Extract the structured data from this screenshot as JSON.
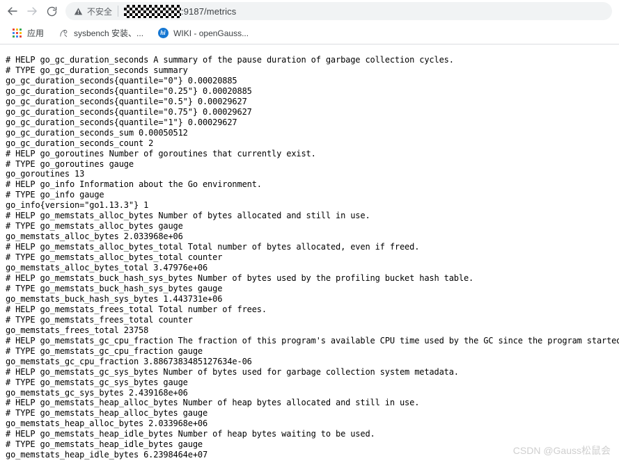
{
  "browser": {
    "nav": {
      "back_icon": "arrow-left-icon",
      "forward_icon": "arrow-right-icon",
      "reload_icon": "reload-icon"
    },
    "omnibox": {
      "security_icon": "warning-triangle-icon",
      "security_label": "不安全",
      "redacted_host": "",
      "url_visible": ":9187/metrics"
    },
    "bookmarks": [
      {
        "icon": "apps-grid-icon",
        "label": "应用"
      },
      {
        "icon": "sysbench-favicon",
        "label": "sysbench 安装、..."
      },
      {
        "icon": "opengauss-wiki-favicon",
        "label": "WIKI - openGauss..."
      }
    ]
  },
  "page": {
    "content": "# HELP go_gc_duration_seconds A summary of the pause duration of garbage collection cycles.\n# TYPE go_gc_duration_seconds summary\ngo_gc_duration_seconds{quantile=\"0\"} 0.00020885\ngo_gc_duration_seconds{quantile=\"0.25\"} 0.00020885\ngo_gc_duration_seconds{quantile=\"0.5\"} 0.00029627\ngo_gc_duration_seconds{quantile=\"0.75\"} 0.00029627\ngo_gc_duration_seconds{quantile=\"1\"} 0.00029627\ngo_gc_duration_seconds_sum 0.00050512\ngo_gc_duration_seconds_count 2\n# HELP go_goroutines Number of goroutines that currently exist.\n# TYPE go_goroutines gauge\ngo_goroutines 13\n# HELP go_info Information about the Go environment.\n# TYPE go_info gauge\ngo_info{version=\"go1.13.3\"} 1\n# HELP go_memstats_alloc_bytes Number of bytes allocated and still in use.\n# TYPE go_memstats_alloc_bytes gauge\ngo_memstats_alloc_bytes 2.033968e+06\n# HELP go_memstats_alloc_bytes_total Total number of bytes allocated, even if freed.\n# TYPE go_memstats_alloc_bytes_total counter\ngo_memstats_alloc_bytes_total 3.47976e+06\n# HELP go_memstats_buck_hash_sys_bytes Number of bytes used by the profiling bucket hash table.\n# TYPE go_memstats_buck_hash_sys_bytes gauge\ngo_memstats_buck_hash_sys_bytes 1.443731e+06\n# HELP go_memstats_frees_total Total number of frees.\n# TYPE go_memstats_frees_total counter\ngo_memstats_frees_total 23758\n# HELP go_memstats_gc_cpu_fraction The fraction of this program's available CPU time used by the GC since the program started.\n# TYPE go_memstats_gc_cpu_fraction gauge\ngo_memstats_gc_cpu_fraction 3.8867383485127634e-06\n# HELP go_memstats_gc_sys_bytes Number of bytes used for garbage collection system metadata.\n# TYPE go_memstats_gc_sys_bytes gauge\ngo_memstats_gc_sys_bytes 2.439168e+06\n# HELP go_memstats_heap_alloc_bytes Number of heap bytes allocated and still in use.\n# TYPE go_memstats_heap_alloc_bytes gauge\ngo_memstats_heap_alloc_bytes 2.033968e+06\n# HELP go_memstats_heap_idle_bytes Number of heap bytes waiting to be used.\n# TYPE go_memstats_heap_idle_bytes gauge\ngo_memstats_heap_idle_bytes 6.2398464e+07"
  },
  "watermark": {
    "text": "CSDN @Gauss松鼠会"
  },
  "colors": {
    "apps_dots": [
      "#ea4335",
      "#fbbc04",
      "#34a853",
      "#4285f4",
      "#ea4335",
      "#fbbc04",
      "#34a853",
      "#4285f4",
      "#ea4335"
    ],
    "wiki_blue": "#1677d2",
    "chrome_bg": "#ffffff",
    "omnibox_bg": "#f1f3f4"
  }
}
